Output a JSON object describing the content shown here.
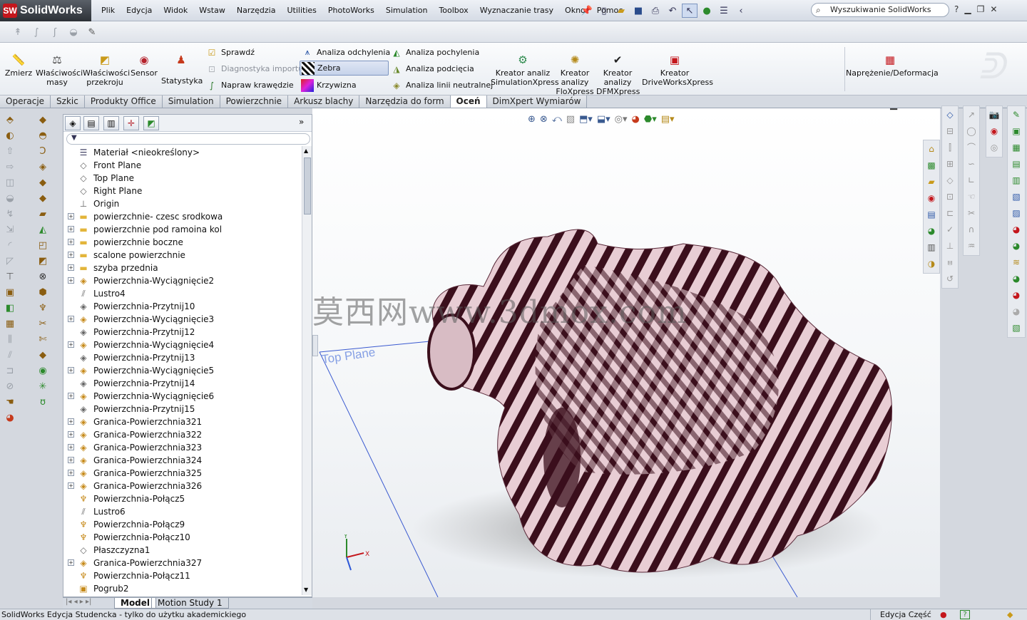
{
  "app": {
    "brand": "SolidWorks",
    "brand_mark": "SW"
  },
  "menu": [
    "Plik",
    "Edycja",
    "Widok",
    "Wstaw",
    "Narzędzia",
    "Utilities",
    "PhotoWorks",
    "Simulation",
    "Toolbox",
    "Wyznaczanie trasy",
    "Okno",
    "Pomoc"
  ],
  "search": {
    "placeholder": "Wyszukiwanie SolidWorks"
  },
  "command_manager": {
    "big_buttons": [
      {
        "label": "Zmierz",
        "icon": "measure-icon"
      },
      {
        "label": "Właściwości masy",
        "icon": "mass-properties-icon"
      },
      {
        "label": "Właściwości przekroju",
        "icon": "section-properties-icon"
      },
      {
        "label": "Sensor",
        "icon": "sensor-icon"
      },
      {
        "label": "Statystyka",
        "icon": "statistics-icon"
      }
    ],
    "check_group": [
      {
        "label": "Sprawdź",
        "enabled": true
      },
      {
        "label": "Diagnostyka importu",
        "enabled": false
      },
      {
        "label": "Napraw krawędzie",
        "enabled": true
      }
    ],
    "analysis_left": [
      {
        "label": "Analiza odchylenia",
        "active": false
      },
      {
        "label": "Zebra",
        "active": true
      },
      {
        "label": "Krzywizna",
        "active": false
      }
    ],
    "analysis_right": [
      {
        "label": "Analiza pochylenia"
      },
      {
        "label": "Analiza podcięcia"
      },
      {
        "label": "Analiza linii neutralnej"
      }
    ],
    "xpress": [
      {
        "label": "Kreator analiz SimulationXpress"
      },
      {
        "label": "Kreator analizy FloXpress"
      },
      {
        "label": "Kreator analizy DFMXpress"
      },
      {
        "label": "Kreator DriveWorksXpress"
      }
    ],
    "stress": {
      "label": "Naprężenie/Deformacja"
    }
  },
  "tabs": [
    {
      "label": "Operacje",
      "active": false
    },
    {
      "label": "Szkic",
      "active": false
    },
    {
      "label": "Produkty Office",
      "active": false
    },
    {
      "label": "Simulation",
      "active": false
    },
    {
      "label": "Powierzchnie",
      "active": false
    },
    {
      "label": "Arkusz blachy",
      "active": false
    },
    {
      "label": "Narzędzia do form",
      "active": false
    },
    {
      "label": "Oceń",
      "active": true
    },
    {
      "label": "DimXpert Wymiarów",
      "active": false
    }
  ],
  "tree": [
    {
      "label": "Materiał <nieokreślony>",
      "icon": "material-icon",
      "expandable": false
    },
    {
      "label": "Front Plane",
      "icon": "plane-icon",
      "expandable": false
    },
    {
      "label": "Top Plane",
      "icon": "plane-icon",
      "expandable": false
    },
    {
      "label": "Right Plane",
      "icon": "plane-icon",
      "expandable": false
    },
    {
      "label": "Origin",
      "icon": "origin-icon",
      "expandable": false
    },
    {
      "label": "powierzchnie- czesc srodkowa",
      "icon": "folder-icon",
      "expandable": true
    },
    {
      "label": "powierzchnie pod ramoina kol",
      "icon": "folder-icon",
      "expandable": true
    },
    {
      "label": "powierzchnie boczne",
      "icon": "folder-icon",
      "expandable": true
    },
    {
      "label": "scalone powierzchnie",
      "icon": "folder-icon",
      "expandable": true
    },
    {
      "label": "szyba przednia",
      "icon": "folder-icon",
      "expandable": true
    },
    {
      "label": "Powierzchnia-Wyciągnięcie2",
      "icon": "surface-extrude-icon",
      "expandable": true
    },
    {
      "label": "Lustro4",
      "icon": "mirror-icon",
      "expandable": false
    },
    {
      "label": "Powierzchnia-Przytnij10",
      "icon": "surface-trim-icon",
      "expandable": false
    },
    {
      "label": "Powierzchnia-Wyciągnięcie3",
      "icon": "surface-extrude-icon",
      "expandable": true
    },
    {
      "label": "Powierzchnia-Przytnij12",
      "icon": "surface-trim-icon",
      "expandable": false
    },
    {
      "label": "Powierzchnia-Wyciągnięcie4",
      "icon": "surface-extrude-icon",
      "expandable": true
    },
    {
      "label": "Powierzchnia-Przytnij13",
      "icon": "surface-trim-icon",
      "expandable": false
    },
    {
      "label": "Powierzchnia-Wyciągnięcie5",
      "icon": "surface-extrude-icon",
      "expandable": true
    },
    {
      "label": "Powierzchnia-Przytnij14",
      "icon": "surface-trim-icon",
      "expandable": false
    },
    {
      "label": "Powierzchnia-Wyciągnięcie6",
      "icon": "surface-extrude-icon",
      "expandable": true
    },
    {
      "label": "Powierzchnia-Przytnij15",
      "icon": "surface-trim-icon",
      "expandable": false
    },
    {
      "label": "Granica-Powierzchnia321",
      "icon": "boundary-surface-icon",
      "expandable": true
    },
    {
      "label": "Granica-Powierzchnia322",
      "icon": "boundary-surface-icon",
      "expandable": true
    },
    {
      "label": "Granica-Powierzchnia323",
      "icon": "boundary-surface-icon",
      "expandable": true
    },
    {
      "label": "Granica-Powierzchnia324",
      "icon": "boundary-surface-icon",
      "expandable": true
    },
    {
      "label": "Granica-Powierzchnia325",
      "icon": "boundary-surface-icon",
      "expandable": true
    },
    {
      "label": "Granica-Powierzchnia326",
      "icon": "boundary-surface-icon",
      "expandable": true
    },
    {
      "label": "Powierzchnia-Połącz5",
      "icon": "surface-knit-icon",
      "expandable": false
    },
    {
      "label": "Lustro6",
      "icon": "mirror-icon",
      "expandable": false
    },
    {
      "label": "Powierzchnia-Połącz9",
      "icon": "surface-knit-icon",
      "expandable": false
    },
    {
      "label": "Powierzchnia-Połącz10",
      "icon": "surface-knit-icon",
      "expandable": false
    },
    {
      "label": "Płaszczyzna1",
      "icon": "plane-icon",
      "expandable": false
    },
    {
      "label": "Granica-Powierzchnia327",
      "icon": "boundary-surface-icon",
      "expandable": true
    },
    {
      "label": "Powierzchnia-Połącz11",
      "icon": "surface-knit-icon",
      "expandable": false
    },
    {
      "label": "Pogrub2",
      "icon": "thicken-icon",
      "expandable": false
    }
  ],
  "bottom_tabs": [
    {
      "label": "Model",
      "active": true
    },
    {
      "label": "Motion Study 1",
      "active": false
    }
  ],
  "viewport": {
    "plane_label": "Top Plane",
    "watermark": "莫西网www.3dmox.com",
    "triad_x": "X",
    "triad_y": "Y",
    "surface_color": "#e8cdd4",
    "stripe_color": "#3b0f1c"
  },
  "status": {
    "left": "SolidWorks Edycja Studencka - tylko do użytku akademickiego",
    "mode": "Edycja Część",
    "help": "?"
  }
}
